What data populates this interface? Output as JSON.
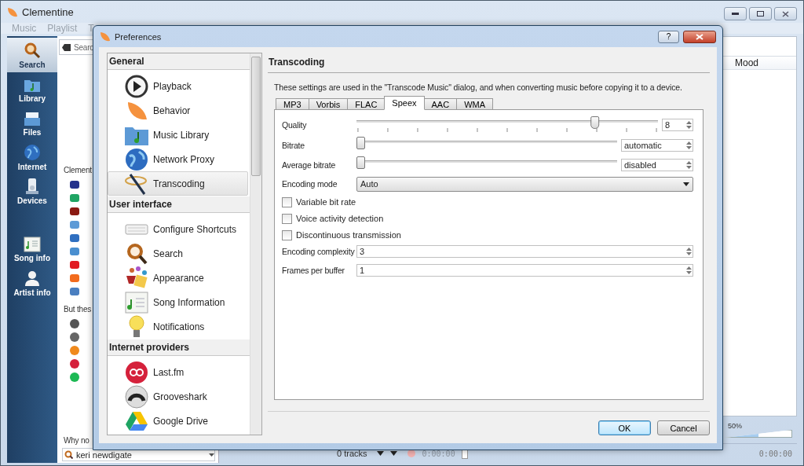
{
  "main_window": {
    "title": "Clementine",
    "menu": [
      "Music",
      "Playlist",
      "T"
    ],
    "sidebar": [
      {
        "label": "Search",
        "selected": true
      },
      {
        "label": "Library",
        "selected": false
      },
      {
        "label": "Files",
        "selected": false
      },
      {
        "label": "Internet",
        "selected": false
      },
      {
        "label": "Devices",
        "selected": false
      },
      {
        "label": "Song info",
        "selected": false
      },
      {
        "label": "Artist info",
        "selected": false
      }
    ],
    "library_panel": {
      "search_placeholder": "Searc",
      "intro": "Clement",
      "services_heading": "But thes",
      "suggestion": "Why no",
      "suggestion_query": "keri newdigate"
    },
    "playlist": {
      "columns": [
        "Mood"
      ]
    },
    "volume": {
      "reading": "50%",
      "level": 0.5
    },
    "status_bar": {
      "track_count": "0 tracks",
      "elapsed": "0:00:00",
      "total": "0:00:00"
    }
  },
  "dialog": {
    "title": "Preferences",
    "help_button": "?",
    "categories": [
      {
        "heading": "General",
        "items": [
          {
            "label": "Playback",
            "selected": false
          },
          {
            "label": "Behavior",
            "selected": false
          },
          {
            "label": "Music Library",
            "selected": false
          },
          {
            "label": "Network Proxy",
            "selected": false
          },
          {
            "label": "Transcoding",
            "selected": true
          }
        ]
      },
      {
        "heading": "User interface",
        "items": [
          {
            "label": "Configure Shortcuts",
            "selected": false
          },
          {
            "label": "Search",
            "selected": false
          },
          {
            "label": "Appearance",
            "selected": false
          },
          {
            "label": "Song Information",
            "selected": false
          },
          {
            "label": "Notifications",
            "selected": false
          }
        ]
      },
      {
        "heading": "Internet providers",
        "items": [
          {
            "label": "Last.fm",
            "selected": false
          },
          {
            "label": "Grooveshark",
            "selected": false
          },
          {
            "label": "Google Drive",
            "selected": false
          }
        ]
      }
    ],
    "page": {
      "title": "Transcoding",
      "description": "These settings are used in the \"Transcode Music\" dialog, and when converting music before copying it to a device.",
      "tabs": [
        {
          "label": "MP3",
          "selected": false
        },
        {
          "label": "Vorbis",
          "selected": false
        },
        {
          "label": "FLAC",
          "selected": false
        },
        {
          "label": "Speex",
          "selected": true
        },
        {
          "label": "AAC",
          "selected": false
        },
        {
          "label": "WMA",
          "selected": false
        }
      ],
      "fields": [
        {
          "kind": "tick-slider",
          "label": "Quality",
          "level": 0.8,
          "value": "8"
        },
        {
          "kind": "slider",
          "label": "Bitrate",
          "level": 0,
          "value": "automatic"
        },
        {
          "kind": "slider",
          "label": "Average bitrate",
          "level": 0,
          "value": "disabled"
        },
        {
          "kind": "combo",
          "label": "Encoding mode",
          "value": "Auto"
        },
        {
          "kind": "checkbox",
          "label": "Variable bit rate",
          "checked": false
        },
        {
          "kind": "checkbox",
          "label": "Voice activity detection",
          "checked": false
        },
        {
          "kind": "checkbox",
          "label": "Discontinuous transmission",
          "checked": false
        },
        {
          "kind": "spin",
          "label": "Encoding complexity",
          "value": "3"
        },
        {
          "kind": "spin",
          "label": "Frames per buffer",
          "value": "1"
        }
      ]
    },
    "buttons": [
      {
        "label": "OK",
        "default": true
      },
      {
        "label": "Cancel",
        "default": false
      }
    ]
  }
}
